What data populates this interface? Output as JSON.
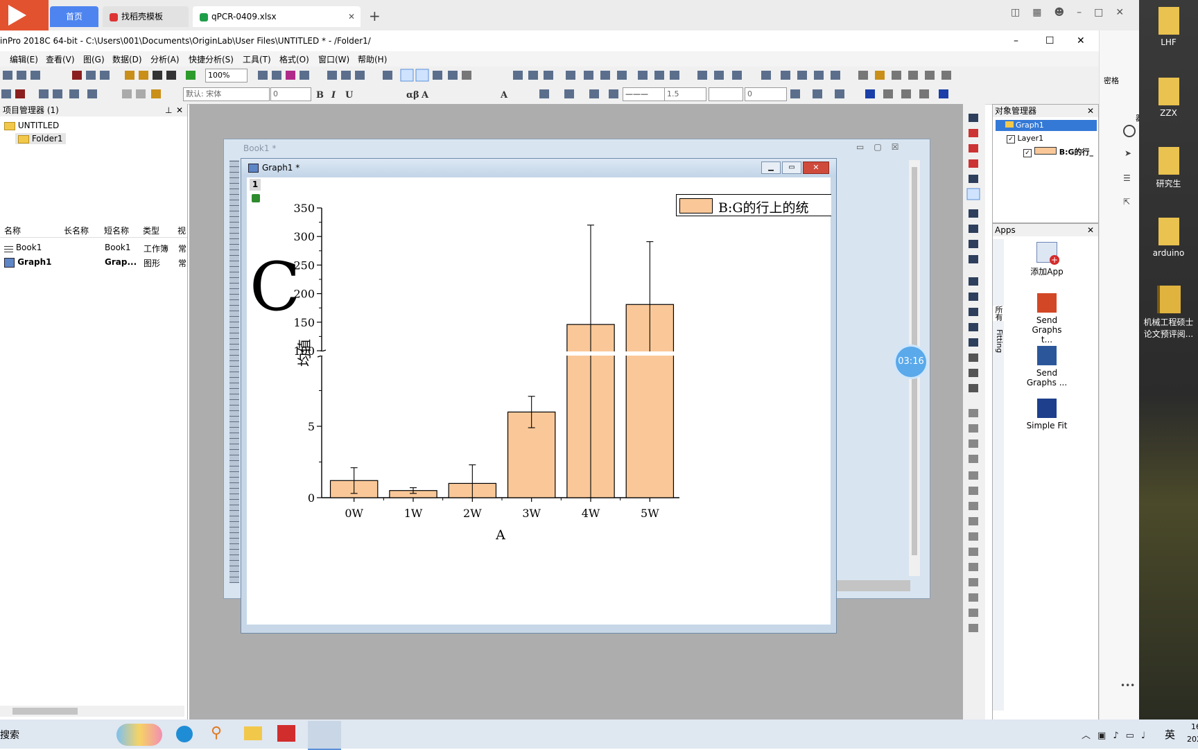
{
  "browser": {
    "tabs": [
      {
        "label": "首页"
      },
      {
        "label": "找稻壳模板"
      },
      {
        "label": "qPCR-0409.xlsx"
      }
    ],
    "new_tab": "+"
  },
  "window": {
    "title": "inPro 2018C 64-bit - C:\\Users\\001\\Documents\\OriginLab\\User Files\\UNTITLED * - /Folder1/"
  },
  "menu": [
    "编辑(E)",
    "查看(V)",
    "图(G)",
    "数据(D)",
    "分析(A)",
    "快捷分析(S)",
    "工具(T)",
    "格式(O)",
    "窗口(W)",
    "帮助(H)"
  ],
  "toolbar": {
    "zoom": "100%",
    "font": "默认: 宋体",
    "font_size": "0",
    "line_width": "1.5",
    "angle": "0"
  },
  "project_manager": {
    "title": "项目管理器 (1)",
    "root": "UNTITLED",
    "folder": "Folder1"
  },
  "project_list": {
    "columns": [
      "名称",
      "长名称",
      "短名称",
      "类型",
      "视"
    ],
    "rows": [
      {
        "name": "Book1",
        "short": "Book1",
        "type": "工作簿",
        "view": "常"
      },
      {
        "name": "Graph1",
        "short": "Grap...",
        "type": "图形",
        "view": "常"
      }
    ]
  },
  "book_window": {
    "title": "Book1 *"
  },
  "graph_window": {
    "title": "Graph1 *",
    "layer_label": "1",
    "panel_letter": "C",
    "legend_text": "B:G的行上的统"
  },
  "chart_data": {
    "type": "bar",
    "categories": [
      "0W",
      "1W",
      "2W",
      "3W",
      "4W",
      "5W"
    ],
    "values": [
      1.2,
      0.5,
      1.0,
      6.0,
      146,
      181
    ],
    "errors": [
      0.9,
      0.2,
      1.3,
      1.1,
      174,
      110
    ],
    "xlabel": "A",
    "ylabel": "均值",
    "axis_break": [
      10,
      100
    ],
    "lower_ticks": [
      "0",
      "5"
    ],
    "upper_ticks": [
      "100",
      "150",
      "200",
      "250",
      "300",
      "350"
    ],
    "ylim": [
      0,
      350
    ],
    "bar_color": "#fac898",
    "grid": false
  },
  "timer": "03:16",
  "object_manager": {
    "title": "对象管理器",
    "items": [
      "Graph1",
      "Layer1",
      "B:G的行_"
    ]
  },
  "apps": {
    "title": "Apps",
    "side_tabs": [
      "所有",
      "Fitting"
    ],
    "items": [
      "添加App",
      "Send Graphs t...",
      "Send Graphs ...",
      "Simple Fit"
    ]
  },
  "desktop": {
    "top_label": "密格",
    "side_label": "器",
    "icons": [
      "LHF",
      "ZZX",
      "研究生",
      "arduino",
      "机械工程硕士论文预评阅..."
    ]
  },
  "taskbar": {
    "search": "搜索",
    "lang": "英",
    "time": "16",
    "date": "202"
  }
}
